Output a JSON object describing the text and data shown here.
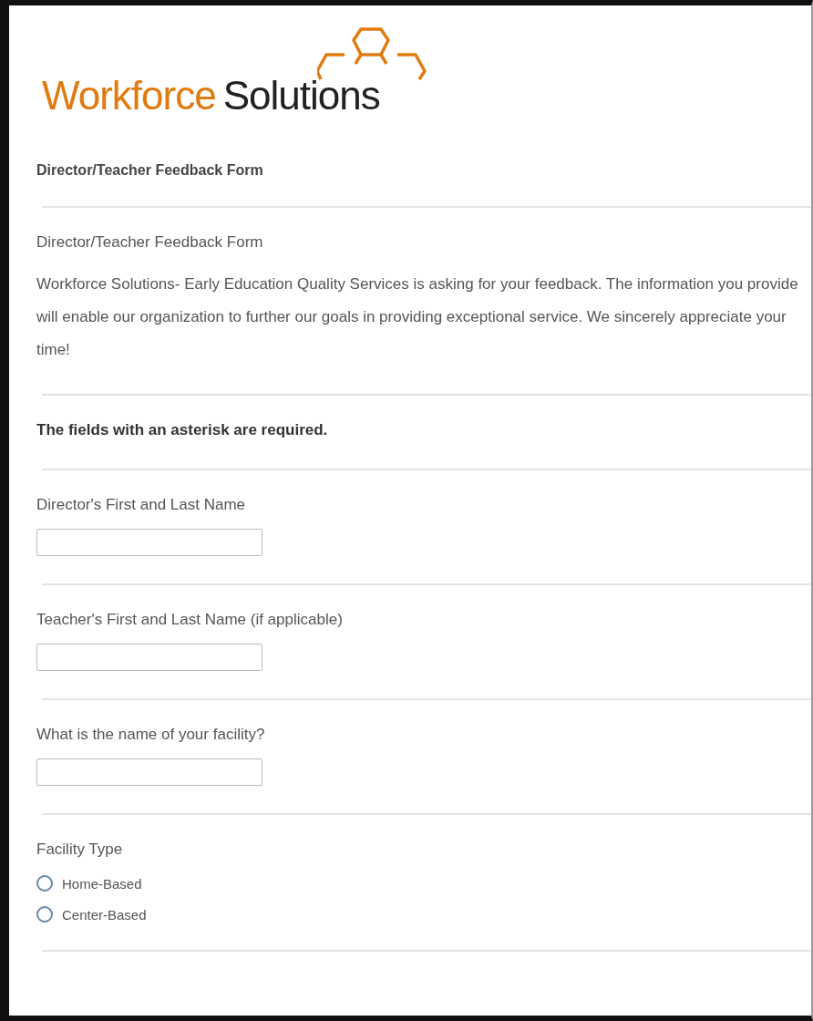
{
  "logo": {
    "word_1": "Workforce",
    "word_2": "Solutions"
  },
  "form_title": "Director/Teacher Feedback Form",
  "intro_title": "Director/Teacher Feedback Form",
  "intro_text": "Workforce Solutions- Early Education Quality Services is asking for your feedback. The information you provide will enable our organization to further our goals in providing exceptional service. We sincerely appreciate your time!",
  "required_note": "The fields with an asterisk are required.",
  "questions": [
    {
      "kind": "text",
      "label": "Director's First and Last Name"
    },
    {
      "kind": "text",
      "label": "Teacher's First and Last Name (if applicable)"
    },
    {
      "kind": "text",
      "label": "What is the name of your facility?"
    },
    {
      "kind": "radio",
      "label": "Facility Type",
      "options": [
        {
          "label": "Home-Based",
          "selected": false
        },
        {
          "label": "Center-Based",
          "selected": false
        }
      ]
    }
  ]
}
